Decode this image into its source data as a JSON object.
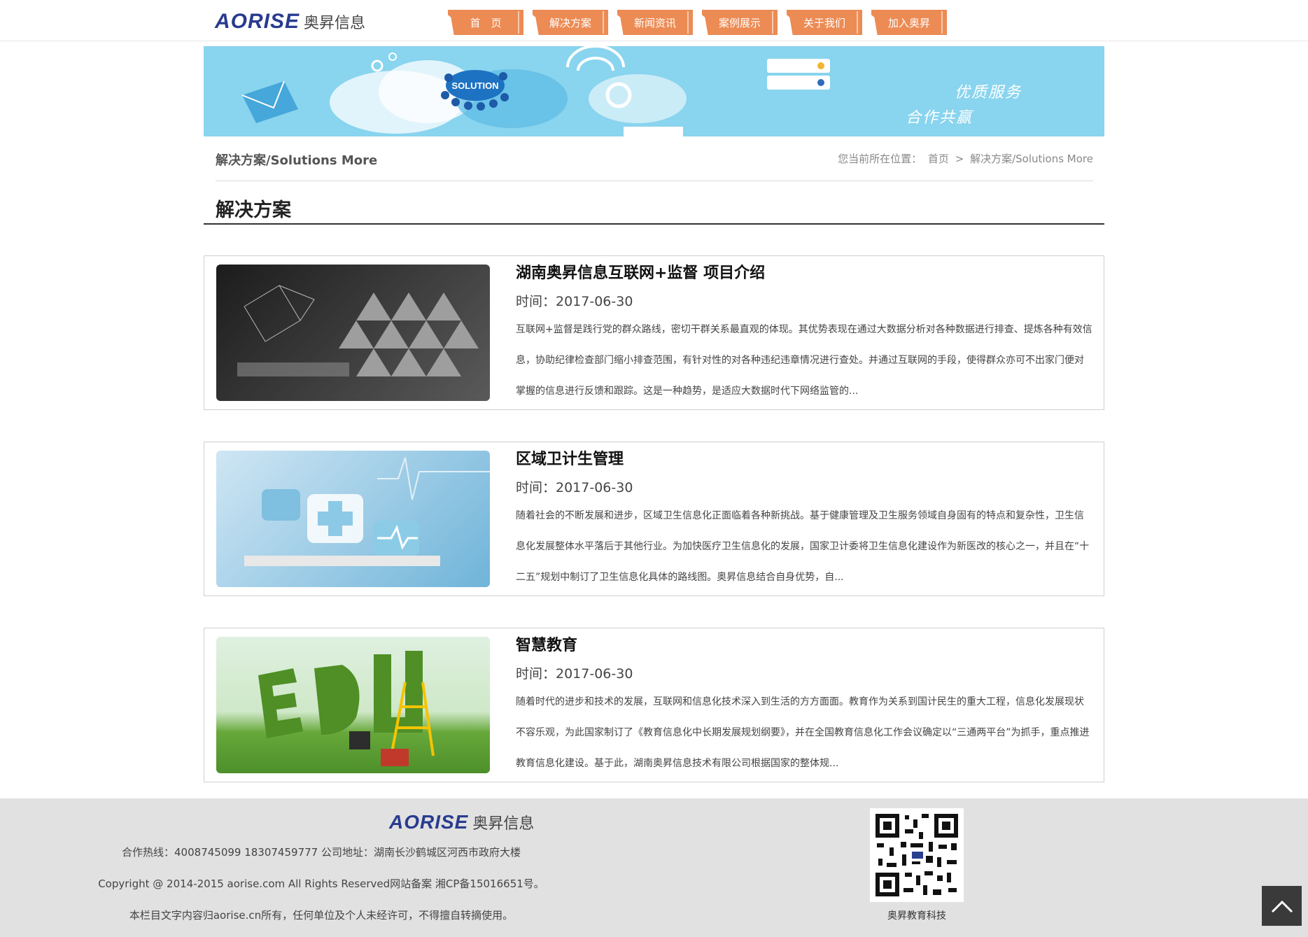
{
  "header": {
    "logo_en": "AORISE",
    "logo_zh": "奥昇信息",
    "nav": [
      "首　页",
      "解决方案",
      "新闻资讯",
      "案例展示",
      "关于我们",
      "加入奥昇"
    ]
  },
  "banner": {
    "bubble_text": "SOLUTION",
    "slogan_1": "优质服务",
    "slogan_2": "合作共赢"
  },
  "breadcrumb": {
    "section_title": "解决方案/Solutions More",
    "prefix": "您当前所在位置：",
    "home": "首页",
    "separator": ">",
    "current": "解决方案/Solutions More"
  },
  "page_heading": "解决方案",
  "articles": [
    {
      "title": "湖南奥昇信息互联网+监督 项目介绍",
      "date": "时间：2017-06-30",
      "desc": "互联网+监督是践行党的群众路线，密切干群关系最直观的体现。其优势表现在通过大数据分析对各种数据进行排查、提炼各种有效信息，协助纪律检查部门缩小排查范围，有针对性的对各种违纪违章情况进行查处。并通过互联网的手段，使得群众亦可不出家门便对掌握的信息进行反馈和跟踪。这是一种趋势，是适应大数据时代下网络监管的..."
    },
    {
      "title": "区域卫计生管理",
      "date": "时间：2017-06-30",
      "desc": "随着社会的不断发展和进步，区域卫生信息化正面临着各种新挑战。基于健康管理及卫生服务领域自身固有的特点和复杂性，卫生信息化发展整体水平落后于其他行业。为加快医疗卫生信息化的发展，国家卫计委将卫生信息化建设作为新医改的核心之一，并且在“十二五”规划中制订了卫生信息化具体的路线图。奥昇信息结合自身优势，自..."
    },
    {
      "title": "智慧教育",
      "date": "时间：2017-06-30",
      "desc": "随着时代的进步和技术的发展，互联网和信息化技术深入到生活的方方面面。教育作为关系到国计民生的重大工程，信息化发展现状不容乐观，为此国家制订了《教育信息化中长期发展规划纲要》，并在全国教育信息化工作会议确定以“三通两平台”为抓手，重点推进教育信息化建设。基于此，湖南奥昇信息技术有限公司根据国家的整体规..."
    }
  ],
  "footer": {
    "logo_en": "AORISE",
    "logo_zh": "奥昇信息",
    "line1": "合作热线：4008745099 18307459777 公司地址：湖南长沙鹤城区河西市政府大楼",
    "line2": "Copyright @ 2014-2015 aorise.com All Rights Reserved网站备案 湘CP备15016651号。",
    "line3": "本栏目文字内容归aorise.cn所有，任何单位及个人未经许可，不得擅自转摘使用。",
    "qr_label": "奥昇教育科技"
  },
  "colors": {
    "nav_bg": "#ec8b54",
    "brand_blue": "#283b8f",
    "banner_bg": "#89d4ee",
    "footer_bg": "#e1e1e1"
  },
  "icons": {
    "back_to_top": "chevron-up-icon"
  }
}
